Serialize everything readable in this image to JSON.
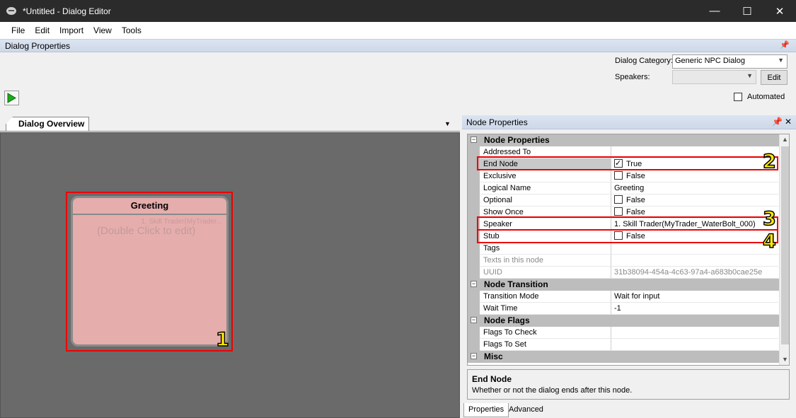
{
  "window": {
    "title": "*Untitled - Dialog Editor",
    "controls": {
      "minimize": "—",
      "maximize": "☐",
      "close": "✕"
    }
  },
  "menu": [
    "File",
    "Edit",
    "Import",
    "View",
    "Tools"
  ],
  "dialog_properties": {
    "header": "Dialog Properties",
    "category_label": "Dialog Category:",
    "category_value": "Generic NPC Dialog",
    "speakers_label": "Speakers:",
    "speakers_value": "",
    "edit_button": "Edit",
    "automated_label": "Automated",
    "automated_checked": false
  },
  "overview": {
    "tab_label": "Dialog Overview",
    "node": {
      "title": "Greeting",
      "speaker_preview": "1. Skill Trader(MyTrader...",
      "hint": "(Double Click to edit)"
    }
  },
  "badges": [
    "1",
    "2",
    "3",
    "4"
  ],
  "node_properties": {
    "header": "Node Properties",
    "rows": [
      {
        "type": "category",
        "name": "Node Properties"
      },
      {
        "name": "Addressed To",
        "value": ""
      },
      {
        "name": "End Node",
        "value": "True",
        "checkbox": true,
        "checked": true
      },
      {
        "name": "Exclusive",
        "value": "False",
        "checkbox": true,
        "checked": false
      },
      {
        "name": "Logical Name",
        "value": "Greeting"
      },
      {
        "name": "Optional",
        "value": "False",
        "checkbox": true,
        "checked": false
      },
      {
        "name": "Show Once",
        "value": "False",
        "checkbox": true,
        "checked": false
      },
      {
        "name": "Speaker",
        "value": "1. Skill Trader(MyTrader_WaterBolt_000)"
      },
      {
        "name": "Stub",
        "value": "False",
        "checkbox": true,
        "checked": false
      },
      {
        "name": "Tags",
        "value": ""
      },
      {
        "name": "Texts in this node",
        "value": "",
        "dim": true
      },
      {
        "name": "UUID",
        "value": "31b38094-454a-4c63-97a4-a683b0cae25e",
        "dim": true
      },
      {
        "type": "category",
        "name": "Node Transition"
      },
      {
        "name": "Transition Mode",
        "value": "Wait for input"
      },
      {
        "name": "Wait Time",
        "value": "-1"
      },
      {
        "type": "category",
        "name": "Node Flags"
      },
      {
        "name": "Flags To Check",
        "value": ""
      },
      {
        "name": "Flags To Set",
        "value": ""
      },
      {
        "type": "category",
        "name": "Misc"
      }
    ],
    "description": {
      "title": "End Node",
      "text": "Whether or not the dialog ends after this node."
    },
    "bottom_tabs": [
      "Properties",
      "Advanced"
    ]
  },
  "colors": {
    "highlight": "#ee0000",
    "badge": "#ffeb00",
    "node_fill": "#e6adad",
    "canvas": "#6a6a6a"
  }
}
